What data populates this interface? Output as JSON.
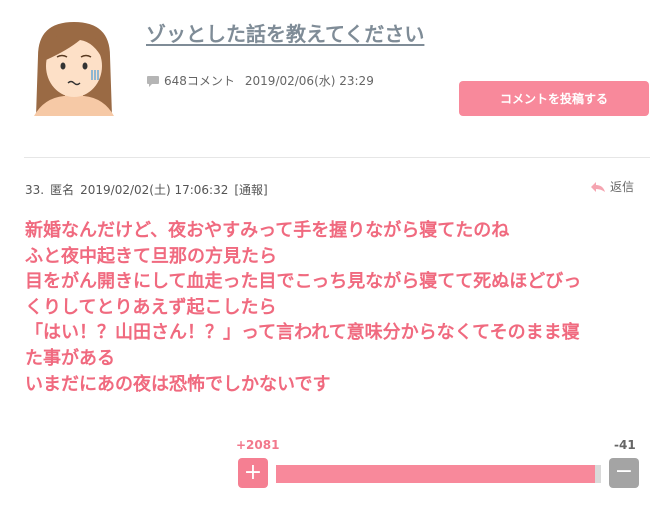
{
  "topic": {
    "title": "ゾッとした話を教えてください",
    "comment_count": "648コメント",
    "date": "2019/02/06(水) 23:29",
    "post_button": "コメントを投稿する",
    "avatar_icon": "worried-woman-icon"
  },
  "comment": {
    "number": "33.",
    "author": "匿名",
    "datetime": "2019/02/02(土) 17:06:32",
    "report": "[通報]",
    "reply_label": "返信",
    "lines": [
      "新婚なんだけど、夜おやすみって手を握りながら寝てたのね",
      "ふと夜中起きて旦那の方見たら",
      "目をがん開きにして血走った目でこっち見ながら寝てて死ぬほどびっ",
      "くりしてとりあえず起こしたら",
      "「はい！？山田さん！？」って言われて意味分からなくてそのまま寝",
      "た事がある",
      "いまだにあの夜は恐怖でしかないです"
    ],
    "color": "#f06a7f"
  },
  "votes": {
    "plus": "+2081",
    "minus": "-41",
    "plus_symbol": "+",
    "minus_symbol": "−",
    "positive_ratio": 0.981,
    "plus_color": "#f57f92",
    "minus_color": "#a4a4a4"
  },
  "colors": {
    "accent": "#f8899b",
    "title": "#7f8c97"
  }
}
